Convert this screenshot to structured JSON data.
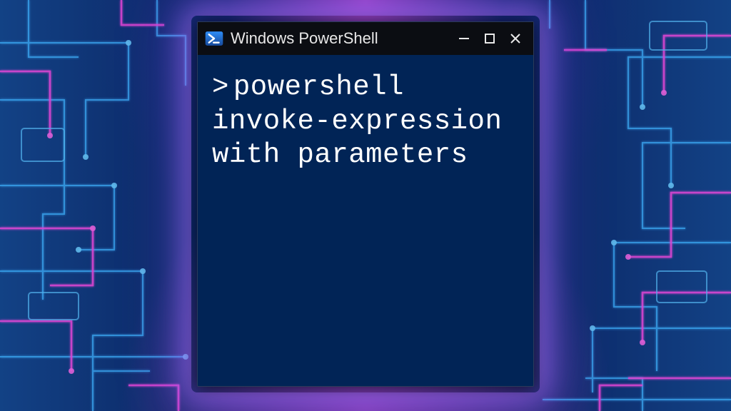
{
  "window": {
    "title": "Windows PowerShell",
    "icon_name": "powershell-icon"
  },
  "controls": {
    "minimize": "−",
    "maximize": "□",
    "close": "×"
  },
  "terminal": {
    "prompt": ">",
    "command": "powershell invoke-expression with parameters"
  },
  "colors": {
    "terminal_bg": "#012456",
    "titlebar_bg": "#0b0d12",
    "text": "#ffffff"
  }
}
